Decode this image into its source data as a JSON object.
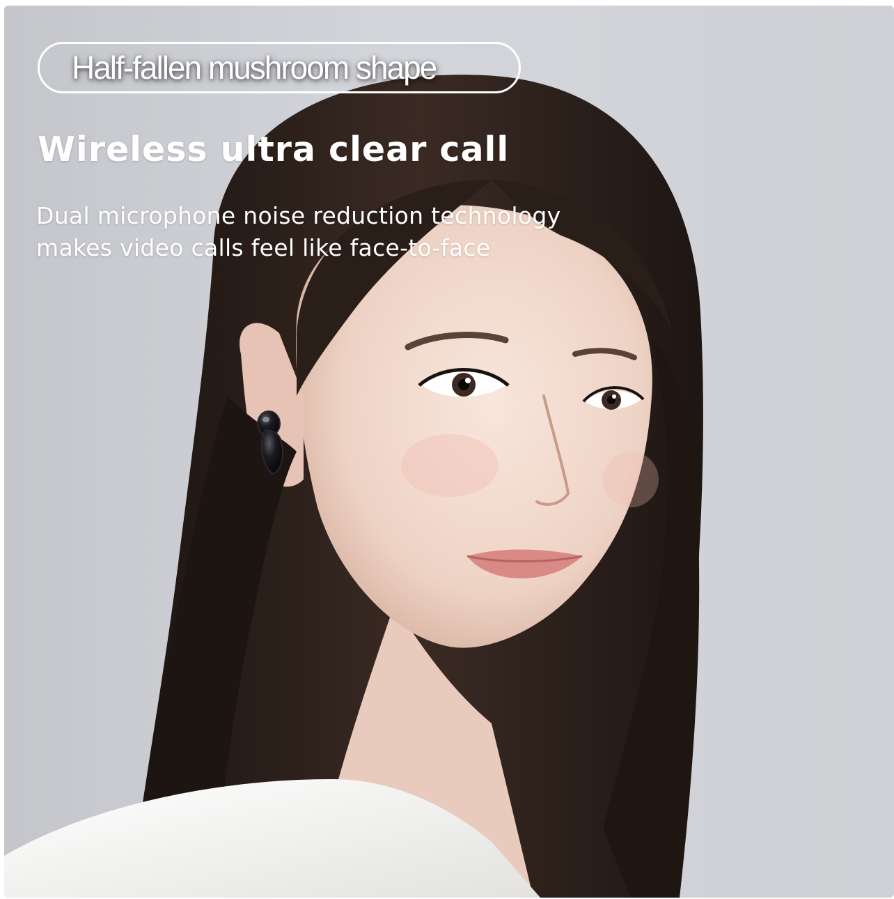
{
  "badge": {
    "text": "Half-fallen mushroom shape"
  },
  "headline": "Wireless ultra clear call",
  "description": {
    "line1": "Dual microphone noise reduction technology",
    "line2": "makes video calls feel like face-to-face"
  },
  "colors": {
    "background": "#cfd1d6",
    "text": "#ffffff",
    "hair": "#241a16",
    "skin": "#f2d8cc",
    "shirt": "#f4f3f1",
    "earbud": "#111114"
  },
  "icons": {
    "earbud": "earbud-icon"
  }
}
